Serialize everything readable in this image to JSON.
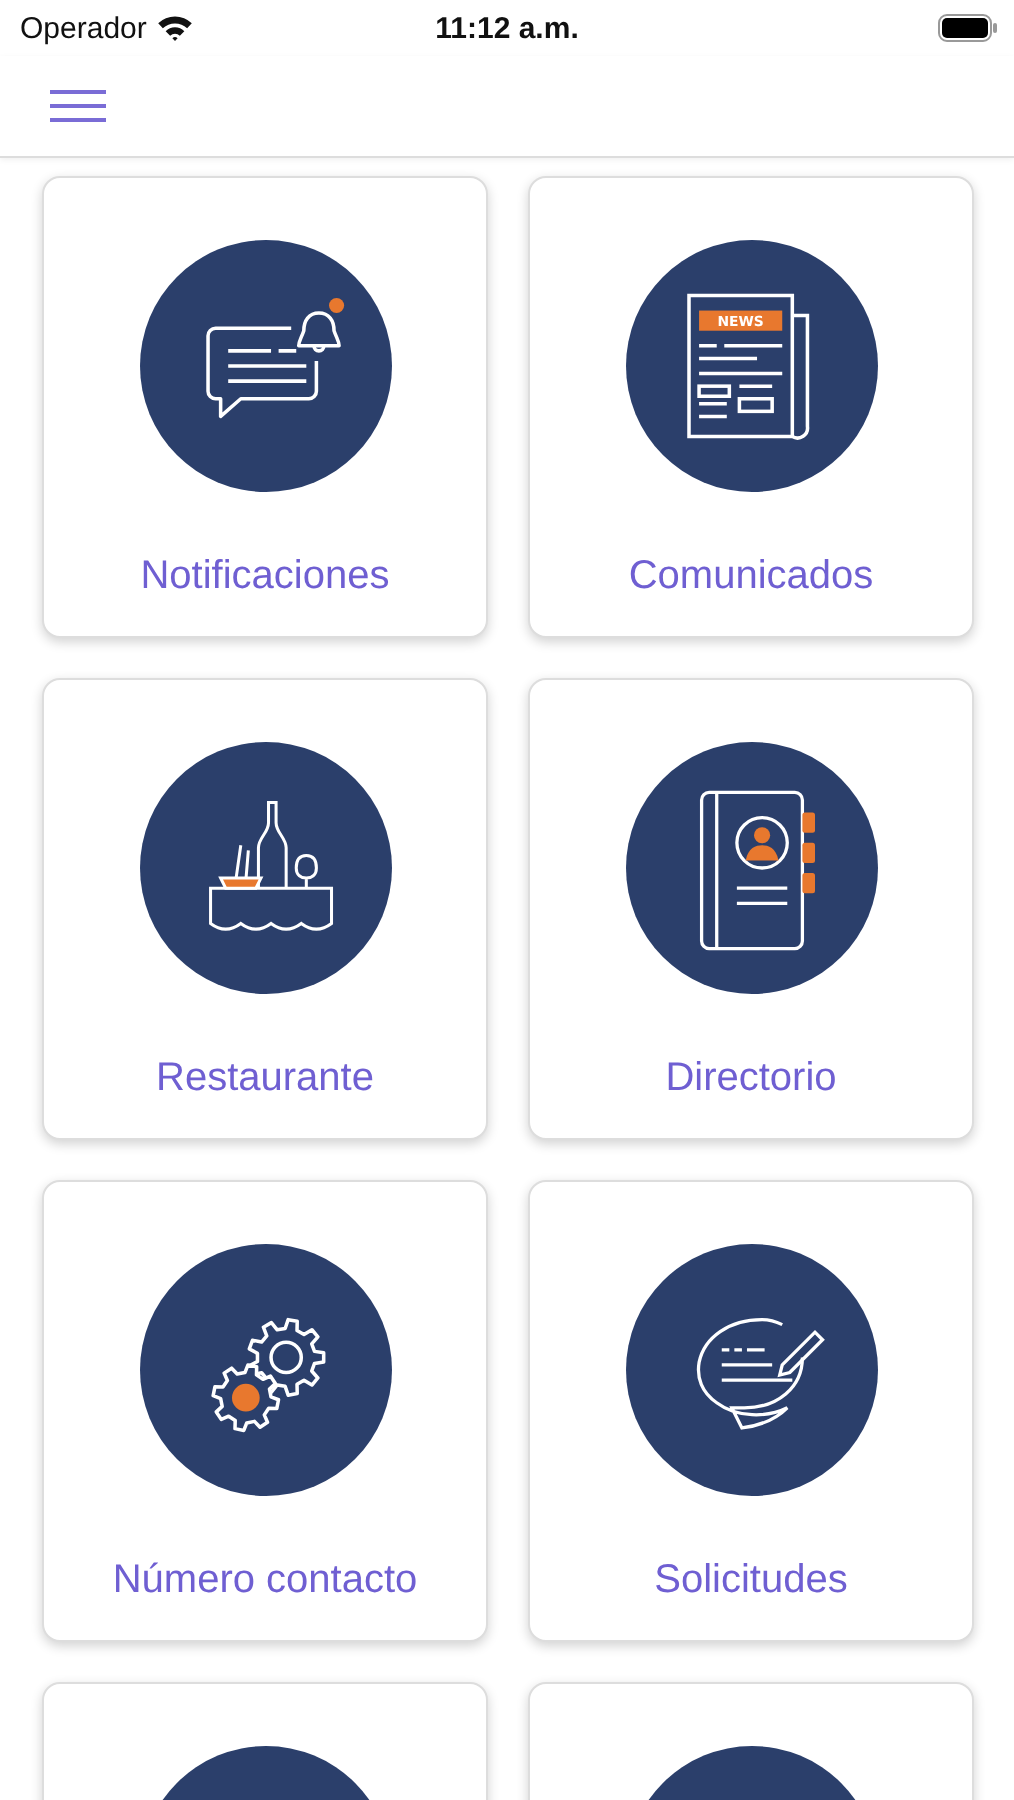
{
  "status_bar": {
    "carrier": "Operador",
    "time": "11:12 a.m."
  },
  "newspaper_icon_text": "NEWS",
  "tiles": [
    {
      "kind": "chat-bell",
      "label": "Notificaciones"
    },
    {
      "kind": "newspaper",
      "label": "Comunicados"
    },
    {
      "kind": "dining",
      "label": "Restaurante"
    },
    {
      "kind": "address-book",
      "label": "Directorio"
    },
    {
      "kind": "gears",
      "label": "Número contacto"
    },
    {
      "kind": "speech-pencil",
      "label": "Solicitudes"
    },
    {
      "kind": "hidden"
    },
    {
      "kind": "hidden"
    }
  ]
}
